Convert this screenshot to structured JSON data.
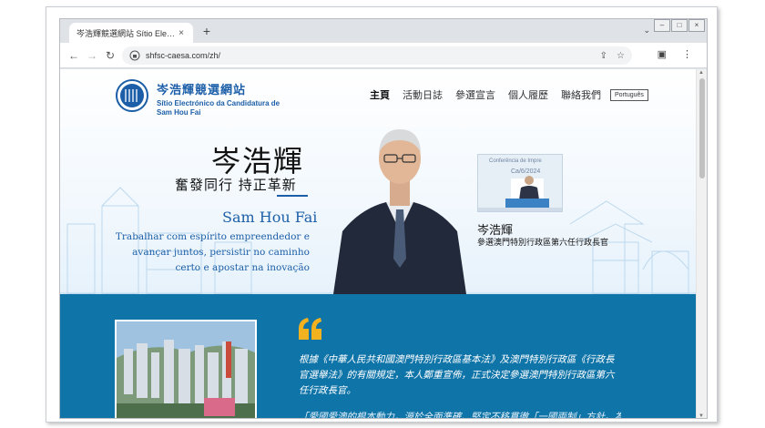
{
  "browser": {
    "tab_title": "岑浩輝競選網站 Sítio Electrónico",
    "tab_close": "×",
    "new_tab": "+",
    "url": "shfsc-caesa.com/zh/"
  },
  "site": {
    "name_cn": "岑浩輝競選網站",
    "name_pt": "Sítio Electrónico da Candidatura de Sam Hou Fai"
  },
  "nav": {
    "items": [
      "主頁",
      "活動日誌",
      "參選宣言",
      "個人履歷",
      "聯絡我們"
    ],
    "lang": "Português"
  },
  "hero": {
    "name_cn": "岑浩輝",
    "motto_cn": "奮發同行 持正革新",
    "name_en": "Sam Hou Fai",
    "motto_pt": "Trabalhar com espírito empreendedor e avançar juntos, persistir no caminho certo e apostar na inovação"
  },
  "photo_card": {
    "banner_text_1": "Conferência de Impre",
    "banner_text_2": "Ca/6/2024",
    "caption_name": "岑浩輝",
    "caption_title": "參選澳門特別行政區第六任行政長官"
  },
  "manifesto": {
    "paragraph_1": "根據《中華人民共和國澳門特別行政區基本法》及澳門特別行政區《行政長官選舉法》的有關規定，本人鄭重宣佈，正式決定參選澳門特別行政區第六任行政長官。",
    "paragraph_2": "「愛國愛澳的根本動力，源於全面準確、堅定不移貫徹「一國兩制」方針。為澳門"
  },
  "colors": {
    "brand_blue": "#1c5fa8",
    "section_blue": "#0f74a8",
    "quote_yellow": "#f2b21f"
  }
}
